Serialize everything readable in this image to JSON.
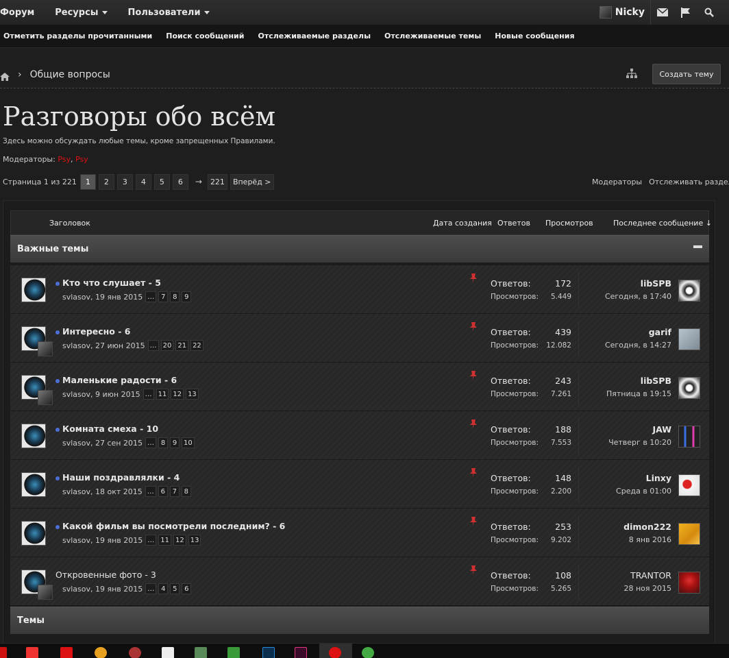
{
  "topnav": {
    "tabs": [
      "Форум",
      "Ресурсы",
      "Пользователи"
    ],
    "user": "Nicky",
    "icons": [
      "envelope-icon",
      "flag-icon",
      "search-icon"
    ]
  },
  "subnav": {
    "links": [
      "Отметить разделы прочитанными",
      "Поиск сообщений",
      "Отслеживаемые разделы",
      "Отслеживаемые темы",
      "Новые сообщения"
    ]
  },
  "breadcrumb": {
    "current": "Общие вопросы",
    "sep": "›"
  },
  "create_button": "Создать тему",
  "page": {
    "title": "Разговоры обо всём",
    "description": "Здесь можно обсуждать любые темы, кроме запрещенных Правилами.",
    "moderators_label": "Модераторы:",
    "moderator1": "Psy",
    "moderator_sep": ",",
    "moderator2": "Psy"
  },
  "pager": {
    "label": "Страница 1 из 221",
    "pages": [
      "1",
      "2",
      "3",
      "4",
      "5",
      "6"
    ],
    "arrow": "→",
    "last": "221",
    "next": "Вперёд >",
    "moderators_link": "Модераторы",
    "follow_link": "Отслеживать раздел"
  },
  "list_head": {
    "title": "Заголовок",
    "created": "Дата создания",
    "replies": "Ответов",
    "views": "Просмотров",
    "last": "Последнее сообщение ↓"
  },
  "sections": {
    "important": "Важные темы",
    "topics": "Темы"
  },
  "stats_labels": {
    "replies": "Ответов:",
    "views": "Просмотров:"
  },
  "threads": [
    {
      "title": "Кто что слушает - 5",
      "meta": "svlasov, 19 янв 2015",
      "pages": [
        "…",
        "7",
        "8",
        "9"
      ],
      "replies": "172",
      "views": "5.449",
      "last_user": "libSPB",
      "last_date": "Сегодня, в 17:40"
    },
    {
      "title": "Интересно - 6",
      "meta": "svlasov, 27 июн 2015",
      "pages": [
        "…",
        "20",
        "21",
        "22"
      ],
      "replies": "439",
      "views": "12.082",
      "last_user": "garif",
      "last_date": "Сегодня, в 14:27"
    },
    {
      "title": "Маленькие радости - 6",
      "meta": "svlasov, 9 июн 2015",
      "pages": [
        "…",
        "11",
        "12",
        "13"
      ],
      "replies": "243",
      "views": "7.261",
      "last_user": "libSPB",
      "last_date": "Пятница в 19:15"
    },
    {
      "title": "Комната смеха - 10",
      "meta": "svlasov, 27 сен 2015",
      "pages": [
        "…",
        "8",
        "9",
        "10"
      ],
      "replies": "188",
      "views": "7.553",
      "last_user": "JAW",
      "last_date": "Четверг в 10:20"
    },
    {
      "title": "Наши поздравлялки - 4",
      "meta": "svlasov, 18 окт 2015",
      "pages": [
        "…",
        "6",
        "7",
        "8"
      ],
      "replies": "148",
      "views": "2.200",
      "last_user": "Linxy",
      "last_date": "Среда в 01:00"
    },
    {
      "title": "Какой фильм вы посмотрели последним? - 6",
      "meta": "svlasov, 19 янв 2015",
      "pages": [
        "…",
        "11",
        "12",
        "13"
      ],
      "replies": "253",
      "views": "9.202",
      "last_user": "dimon222",
      "last_date": "8 янв 2016"
    },
    {
      "title": "Откровенные фото - 3",
      "meta": "svlasov, 19 янв 2015",
      "pages": [
        "…",
        "4",
        "5",
        "6"
      ],
      "replies": "108",
      "views": "5.265",
      "last_user": "TRANTOR",
      "last_date": "28 ноя 2015"
    }
  ],
  "colors": {
    "moderator": "#d11111",
    "pin": "#d13030",
    "unread_dot": "#4b6fd6"
  }
}
